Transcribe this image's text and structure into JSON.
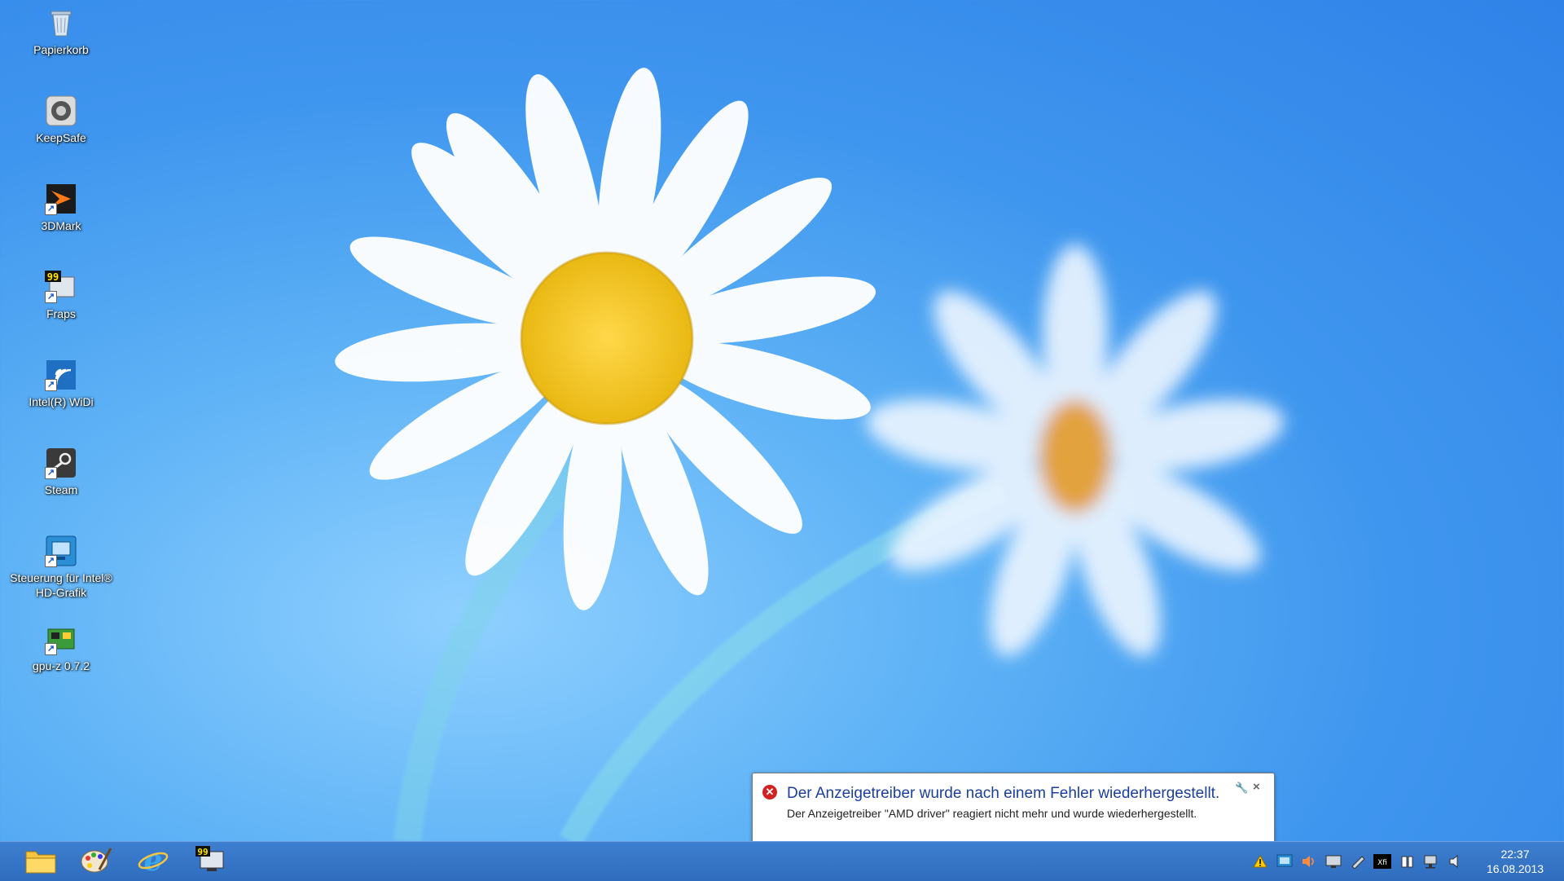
{
  "desktop": {
    "icons": [
      {
        "label": "Papierkorb",
        "icon": "recycle-bin-icon"
      },
      {
        "label": "KeepSafe",
        "icon": "keepsafe-icon"
      },
      {
        "label": "3DMark",
        "icon": "3dmark-icon"
      },
      {
        "label": "Fraps",
        "icon": "fraps-icon"
      },
      {
        "label": "Intel(R) WiDi",
        "icon": "intel-widi-icon"
      },
      {
        "label": "Steam",
        "icon": "steam-icon"
      },
      {
        "label": "Steuerung für Intel® HD-Grafik",
        "icon": "intel-graphics-control-icon"
      },
      {
        "label": "gpu-z 0.7.2",
        "icon": "gpu-z-icon"
      }
    ],
    "fraps_badge": "99"
  },
  "notification": {
    "title": "Der Anzeigetreiber wurde nach einem Fehler wiederhergestellt.",
    "message": "Der Anzeigetreiber \"AMD driver\" reagiert nicht mehr und wurde wiederhergestellt.",
    "icon": "error-icon",
    "close_glyph": "×",
    "options_glyph": "🔧"
  },
  "taskbar": {
    "apps": [
      {
        "name": "file-explorer-icon"
      },
      {
        "name": "paint-icon"
      },
      {
        "name": "internet-explorer-icon"
      },
      {
        "name": "fraps-monitor-icon",
        "badge": "99"
      }
    ],
    "tray_icons": [
      "warning-icon",
      "display-settings-icon",
      "volume-icon",
      "monitor-icon",
      "pen-icon",
      "xfi-icon",
      "battery-icon",
      "network-icon",
      "speaker-icon"
    ],
    "clock": {
      "time": "22:37",
      "date": "16.08.2013"
    }
  },
  "colors": {
    "accent": "#2f6cbd",
    "error": "#d32222",
    "notification_title": "#1a3f9c"
  }
}
